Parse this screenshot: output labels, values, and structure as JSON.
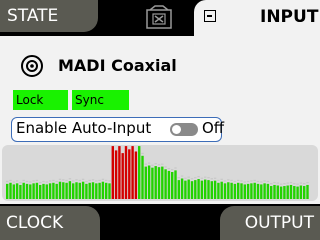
{
  "header": {
    "state_tab": "STATE",
    "input_tab": "INPUT",
    "center_icon": "disconnected-screen-icon",
    "collapse_icon": "minus-box-icon"
  },
  "device": {
    "icon": "coax-connector-icon",
    "name": "MADI Coaxial"
  },
  "status": {
    "lock": "Lock",
    "sync": "Sync",
    "active_color": "#19f200"
  },
  "auto_input": {
    "label": "Enable Auto-Input",
    "state": "Off"
  },
  "footer": {
    "clock": "CLOCK",
    "output": "OUTPUT"
  },
  "meters": {
    "channel_levels": [
      0.28,
      0.3,
      0.27,
      0.29,
      0.26,
      0.3,
      0.28,
      0.27,
      0.29,
      0.3,
      0.26,
      0.28,
      0.27,
      0.29,
      0.3,
      0.28,
      0.32,
      0.31,
      0.3,
      0.33,
      0.29,
      0.31,
      0.3,
      0.32,
      0.28,
      0.3,
      0.31,
      0.29,
      0.3,
      0.32,
      0.3,
      0.29,
      0.98,
      0.9,
      0.98,
      0.85,
      0.98,
      0.92,
      0.98,
      0.88,
      0.98,
      0.8,
      0.6,
      0.62,
      0.58,
      0.61,
      0.59,
      0.6,
      0.55,
      0.52,
      0.5,
      0.53,
      0.35,
      0.38,
      0.34,
      0.36,
      0.33,
      0.35,
      0.37,
      0.34,
      0.36,
      0.35,
      0.33,
      0.34,
      0.3,
      0.32,
      0.29,
      0.31,
      0.3,
      0.28,
      0.3,
      0.29,
      0.27,
      0.28,
      0.29,
      0.3,
      0.28,
      0.27,
      0.29,
      0.28,
      0.24,
      0.26,
      0.25,
      0.23,
      0.24,
      0.25,
      0.26,
      0.24,
      0.23,
      0.25,
      0.24,
      0.26
    ],
    "clip_channels": [
      32,
      33,
      34,
      35,
      36,
      37,
      38,
      39
    ],
    "peak_color": "#d40000",
    "level_color": "#22d300"
  }
}
